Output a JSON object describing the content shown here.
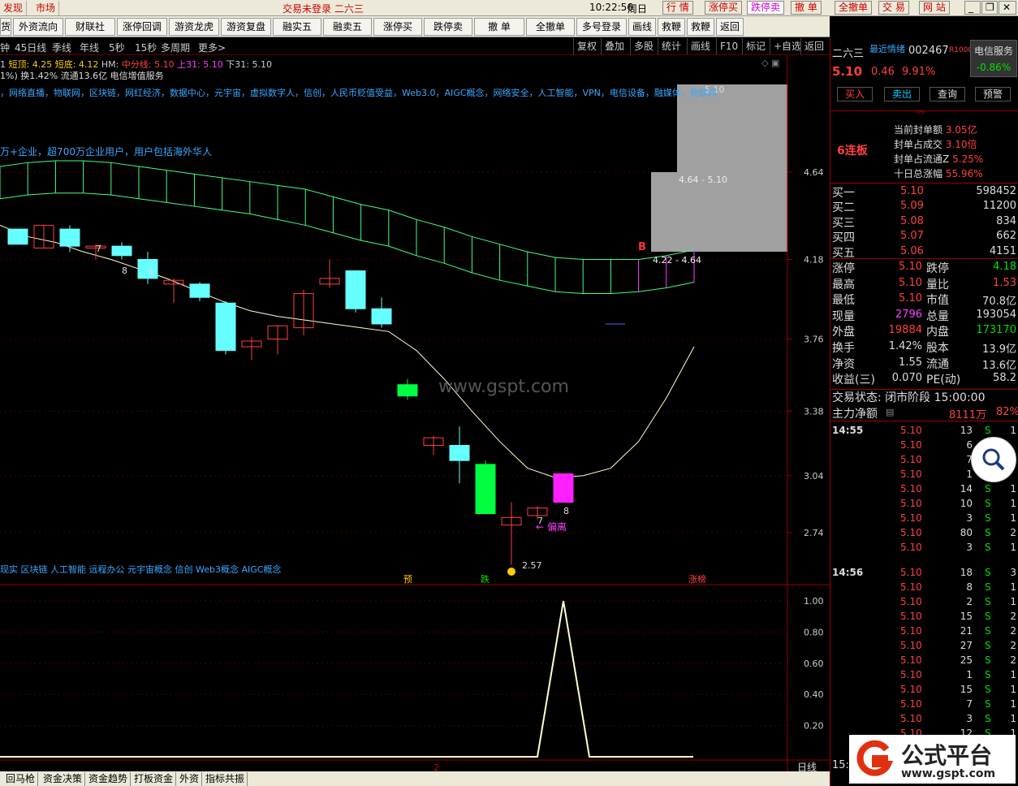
{
  "titlebar": {
    "tabs": [
      "发现",
      "市场"
    ],
    "status": "交易未登录  二六三",
    "time": "10:22:56",
    "weekday": "周日",
    "buttons": [
      "行 情",
      "涨停买",
      "跌停卖",
      "撤 单",
      "全撤单",
      "交 易",
      "网 站"
    ]
  },
  "toolbar": {
    "buttons": [
      "外资流向",
      "财联社",
      "涨停回调",
      "游资龙虎",
      "游资复盘",
      "融实五",
      "融卖五",
      "涨停买",
      "跌停卖",
      "撤 单",
      "全撤单",
      "多号登录",
      "画线",
      "救鞭A",
      "救鞭B",
      "返回"
    ],
    "first": "货"
  },
  "period": {
    "items": [
      "钟",
      "45日线",
      "季线",
      "年线",
      "5秒",
      "15秒",
      "多周期",
      "更多>"
    ],
    "right": [
      "复权",
      "叠加",
      "多股",
      "统计",
      "画线",
      "F10",
      "标记",
      "+自选",
      "返回"
    ]
  },
  "indicator": {
    "line1": [
      {
        "t": "1",
        "c": "#ccc"
      },
      {
        "t": "短顶: 4.25",
        "c": "#ffcc00"
      },
      {
        "t": "短底: 4.12",
        "c": "#ffcc00"
      },
      {
        "t": "HM:",
        "c": "#ccc"
      },
      {
        "t": "中分线: 5.10",
        "c": "#ff4040"
      },
      {
        "t": "上31: 5.10",
        "c": "#ff40ff"
      },
      {
        "t": "下31: 5.10",
        "c": "#ccc"
      }
    ],
    "line2": "1%) 换1.42% 流通13.6亿 电信增值服务",
    "concepts": "，网络直播，物联网，区块链，网红经济，数据中心，元宇宙，虚拟数字人，信创，人民币贬值受益，Web3.0，AIGC概念，网络安全，人工智能，VPN，电信设备，融媒体，物联网",
    "desc": "万+企业，超700万企业用户，用户包括海外华人",
    "bottom_concepts": "现实 区块链 人工智能 远程办公 元宇宙概念 信创 Web3概念 AIGC概念",
    "watermark": "www.gspt.com"
  },
  "chart_labels": {
    "zone_top": "5.10",
    "zone_mid": "4.64 - 5.10",
    "zone_low": "4.22 - 4.64",
    "b_mark": "B",
    "low_label": "2.57",
    "pianli": "偏离",
    "bar_labels": [
      "7",
      "8",
      "9",
      "8",
      "7"
    ],
    "events": [
      "预",
      "跌",
      "涨榜"
    ]
  },
  "chart_data": {
    "type": "line",
    "y_ticks": [
      4.64,
      4.18,
      3.76,
      3.38,
      3.04,
      2.74
    ],
    "sub_y_ticks": [
      "1.00",
      "0.80",
      "0.60",
      "0.40",
      "0.20"
    ],
    "candles": [
      {
        "o": 4.26,
        "c": 4.34,
        "h": 4.34,
        "l": 4.26,
        "up": false,
        "col": "#66ffff"
      },
      {
        "o": 4.24,
        "c": 4.36,
        "h": 4.36,
        "l": 4.24,
        "up": true,
        "col": "#ff4040"
      },
      {
        "o": 4.34,
        "c": 4.25,
        "h": 4.36,
        "l": 4.22,
        "up": false,
        "col": "#66ffff"
      },
      {
        "o": 4.24,
        "c": 4.25,
        "h": 4.26,
        "l": 4.18,
        "up": true,
        "col": "#ff4040"
      },
      {
        "o": 4.25,
        "c": 4.2,
        "h": 4.27,
        "l": 4.18,
        "up": false,
        "col": "#66ffff"
      },
      {
        "o": 4.18,
        "c": 4.08,
        "h": 4.22,
        "l": 4.05,
        "up": false,
        "col": "#66ffff"
      },
      {
        "o": 4.07,
        "c": 4.05,
        "h": 4.08,
        "l": 3.95,
        "up": true,
        "col": "#ff4040"
      },
      {
        "o": 4.05,
        "c": 3.98,
        "h": 4.06,
        "l": 3.96,
        "up": false,
        "col": "#66ffff"
      },
      {
        "o": 3.95,
        "c": 3.7,
        "h": 3.96,
        "l": 3.68,
        "up": false,
        "col": "#66ffff"
      },
      {
        "o": 3.72,
        "c": 3.75,
        "h": 3.77,
        "l": 3.65,
        "up": true,
        "col": "#ff4040"
      },
      {
        "o": 3.76,
        "c": 3.83,
        "h": 3.83,
        "l": 3.68,
        "up": true,
        "col": "#ff4040"
      },
      {
        "o": 3.82,
        "c": 4.0,
        "h": 4.02,
        "l": 3.78,
        "up": true,
        "col": "#ff4040"
      },
      {
        "o": 4.05,
        "c": 4.08,
        "h": 4.18,
        "l": 4.03,
        "up": true,
        "col": "#ff4040"
      },
      {
        "o": 4.12,
        "c": 3.92,
        "h": 4.12,
        "l": 3.9,
        "up": false,
        "col": "#66ffff"
      },
      {
        "o": 3.92,
        "c": 3.84,
        "h": 3.98,
        "l": 3.82,
        "up": false,
        "col": "#66ffff"
      },
      {
        "o": 3.52,
        "c": 3.46,
        "h": 3.55,
        "l": 3.44,
        "up": false,
        "col": "#00ff40"
      },
      {
        "o": 3.2,
        "c": 3.24,
        "h": 3.25,
        "l": 3.15,
        "up": true,
        "col": "#ff4040"
      },
      {
        "o": 3.2,
        "c": 3.12,
        "h": 3.3,
        "l": 3.0,
        "up": false,
        "col": "#66ffff"
      },
      {
        "o": 3.1,
        "c": 2.84,
        "h": 3.12,
        "l": 2.84,
        "up": false,
        "col": "#00ff40"
      },
      {
        "o": 2.78,
        "c": 2.82,
        "h": 2.9,
        "l": 2.57,
        "up": true,
        "col": "#ff4040"
      },
      {
        "o": 2.83,
        "c": 2.87,
        "h": 2.88,
        "l": 2.81,
        "up": true,
        "col": "#ff4040"
      },
      {
        "o": 2.9,
        "c": 3.05,
        "h": 3.05,
        "l": 2.9,
        "up": false,
        "col": "#ff20ff"
      }
    ],
    "ma_line": [
      4.36,
      4.3,
      4.27,
      4.22,
      4.18,
      4.13,
      4.08,
      4.02,
      3.96,
      3.91,
      3.88,
      3.86,
      3.84,
      3.82,
      3.8,
      3.7,
      3.55,
      3.38,
      3.22,
      3.08,
      3.03,
      3.04,
      3.08,
      3.22,
      3.45,
      3.72
    ],
    "band_upper": [
      4.67,
      4.69,
      4.7,
      4.7,
      4.69,
      4.67,
      4.65,
      4.63,
      4.61,
      4.59,
      4.57,
      4.55,
      4.51,
      4.47,
      4.44,
      4.39,
      4.35,
      4.3,
      4.26,
      4.22,
      4.19,
      4.18,
      4.18,
      4.18,
      4.2,
      4.23
    ],
    "band_lower": [
      4.5,
      4.52,
      4.53,
      4.53,
      4.52,
      4.5,
      4.48,
      4.46,
      4.44,
      4.42,
      4.39,
      4.36,
      4.32,
      4.28,
      4.25,
      4.2,
      4.16,
      4.11,
      4.07,
      4.04,
      4.01,
      4.0,
      4.0,
      4.01,
      4.03,
      4.06
    ],
    "sub_line": [
      0,
      0,
      0,
      0,
      0,
      0,
      0,
      0,
      0,
      0,
      0,
      0,
      0,
      0,
      0,
      0,
      0,
      0,
      0,
      0,
      0,
      1.0,
      0,
      0,
      0,
      0
    ]
  },
  "panel": {
    "stock_name": "二六三",
    "subtitle": "最近情绪",
    "code": "002467",
    "r_tag": "R1000",
    "sector": "电信服务",
    "sector_chg": "-0.86%",
    "price": "5.10",
    "change": "0.46",
    "pct": "9.91%",
    "actions": [
      "买入",
      "卖出",
      "查询",
      "预警"
    ],
    "lianban": "6连板",
    "seal": [
      {
        "k": "当前封单额",
        "v": "3.05亿"
      },
      {
        "k": "封单占成交",
        "v": "3.10倍"
      },
      {
        "k": "封单占流通Z",
        "v": "5.25%"
      },
      {
        "k": "十日总涨幅",
        "v": "55.96%"
      }
    ],
    "bids": [
      {
        "k": "买一",
        "p": "5.10",
        "v": "598452"
      },
      {
        "k": "买二",
        "p": "5.09",
        "v": "11200"
      },
      {
        "k": "买三",
        "p": "5.08",
        "v": "834"
      },
      {
        "k": "买四",
        "p": "5.07",
        "v": "662"
      },
      {
        "k": "买五",
        "p": "5.06",
        "v": "4151"
      }
    ],
    "stats": [
      {
        "k1": "涨停",
        "v1": "5.10",
        "c1": "red",
        "k2": "跌停",
        "v2": "4.18",
        "c2": "grn"
      },
      {
        "k1": "最高",
        "v1": "5.10",
        "c1": "red",
        "k2": "量比",
        "v2": "1.53",
        "c2": "red"
      },
      {
        "k1": "最低",
        "v1": "5.10",
        "c1": "red",
        "k2": "市值",
        "v2": "70.8亿",
        "c2": "wht"
      },
      {
        "k1": "现量",
        "v1": "2796",
        "c1": "mag",
        "k2": "总量",
        "v2": "193054",
        "c2": "wht"
      },
      {
        "k1": "外盘",
        "v1": "19884",
        "c1": "red",
        "k2": "内盘",
        "v2": "173170",
        "c2": "grn"
      },
      {
        "k1": "换手",
        "v1": "1.42%",
        "c1": "wht",
        "k2": "股本",
        "v2": "13.9亿",
        "c2": "wht"
      },
      {
        "k1": "净资",
        "v1": "1.55",
        "c1": "wht",
        "k2": "流通",
        "v2": "13.6亿",
        "c2": "wht"
      },
      {
        "k1": "收益(三)",
        "v1": "0.070",
        "c1": "wht",
        "k2": "PE(动)",
        "v2": "58.2",
        "c2": "wht"
      }
    ],
    "trade_state": "交易状态: 闭市阶段 15:00:00",
    "main_flow": "主力净额",
    "main_flow_v": "8111万",
    "main_flow_p": "82%",
    "ticks": [
      {
        "t": "14:55",
        "p": "5.10",
        "v": "13",
        "s": "S",
        "n": "1"
      },
      {
        "t": "",
        "p": "5.10",
        "v": "6",
        "s": "",
        "n": ""
      },
      {
        "t": "",
        "p": "5.10",
        "v": "7",
        "s": "",
        "n": ""
      },
      {
        "t": "",
        "p": "5.10",
        "v": "1",
        "s": "",
        "n": ""
      },
      {
        "t": "",
        "p": "5.10",
        "v": "14",
        "s": "S",
        "n": "1"
      },
      {
        "t": "",
        "p": "5.10",
        "v": "10",
        "s": "S",
        "n": "1"
      },
      {
        "t": "",
        "p": "5.10",
        "v": "3",
        "s": "S",
        "n": "1"
      },
      {
        "t": "",
        "p": "5.10",
        "v": "80",
        "s": "S",
        "n": "2"
      },
      {
        "t": "",
        "p": "5.10",
        "v": "3",
        "s": "S",
        "n": "1"
      },
      {
        "t": "14:56",
        "p": "5.10",
        "v": "18",
        "s": "S",
        "n": "3"
      },
      {
        "t": "",
        "p": "5.10",
        "v": "8",
        "s": "S",
        "n": "1"
      },
      {
        "t": "",
        "p": "5.10",
        "v": "2",
        "s": "S",
        "n": "1"
      },
      {
        "t": "",
        "p": "5.10",
        "v": "15",
        "s": "S",
        "n": "2"
      },
      {
        "t": "",
        "p": "5.10",
        "v": "21",
        "s": "S",
        "n": "2"
      },
      {
        "t": "",
        "p": "5.10",
        "v": "27",
        "s": "S",
        "n": "2"
      },
      {
        "t": "",
        "p": "5.10",
        "v": "25",
        "s": "S",
        "n": "2"
      },
      {
        "t": "",
        "p": "5.10",
        "v": "1",
        "s": "S",
        "n": "1"
      },
      {
        "t": "",
        "p": "5.10",
        "v": "15",
        "s": "S",
        "n": "1"
      },
      {
        "t": "",
        "p": "5.10",
        "v": "7",
        "s": "S",
        "n": "1"
      },
      {
        "t": "",
        "p": "5.10",
        "v": "3",
        "s": "S",
        "n": "1"
      },
      {
        "t": "",
        "p": "5.10",
        "v": "12",
        "s": "S",
        "n": "1"
      }
    ],
    "last_time": "15:"
  },
  "bottom": {
    "tabs": [
      "回马枪",
      "资金决策",
      "资金趋势",
      "打板资金",
      "外资",
      "指标共振"
    ],
    "page": "2",
    "daily": "日线"
  },
  "logo": {
    "brand": "公式平台",
    "url": "www.gspt.com"
  }
}
